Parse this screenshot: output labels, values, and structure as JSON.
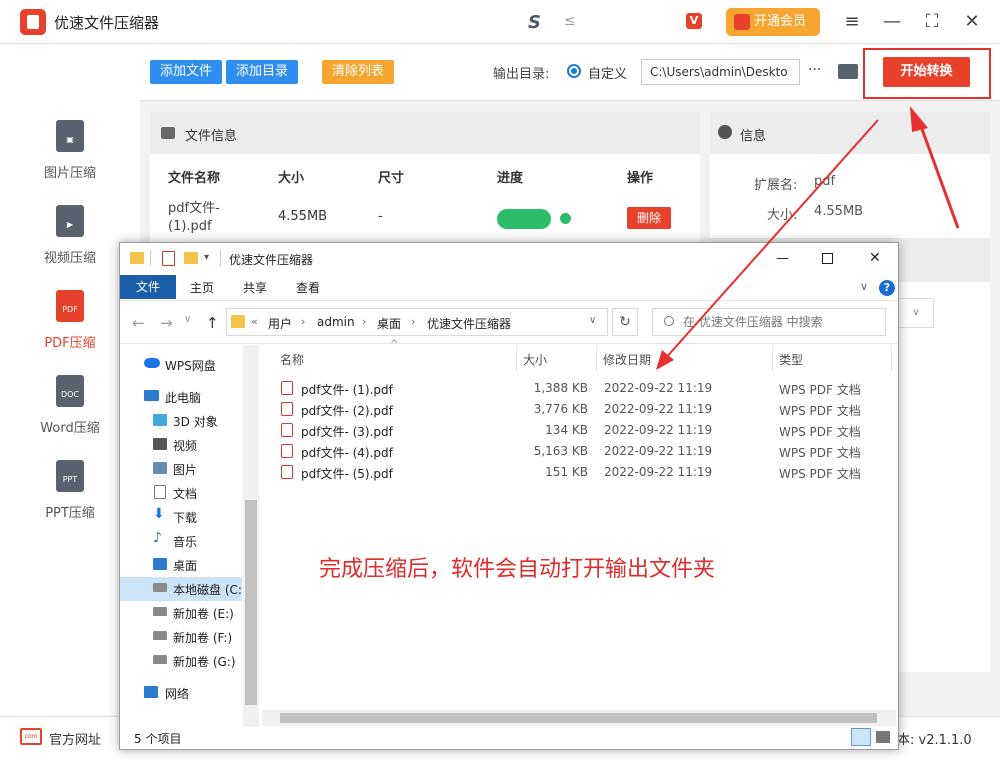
{
  "app": {
    "title": "优速文件压缩器",
    "center_logo": "S",
    "center_logo_suffix": "≤",
    "vip_label": "开通会员",
    "window_controls": [
      "≡",
      "—",
      "⛶",
      "✕"
    ]
  },
  "sidebar": {
    "items": [
      {
        "label": "图片压缩",
        "icon": "image-file-icon",
        "badge": "▣"
      },
      {
        "label": "视频压缩",
        "icon": "video-file-icon",
        "badge": "▶"
      },
      {
        "label": "PDF压缩",
        "icon": "pdf-file-icon",
        "badge": "PDF",
        "active": true
      },
      {
        "label": "Word压缩",
        "icon": "doc-file-icon",
        "badge": "DOC"
      },
      {
        "label": "PPT压缩",
        "icon": "ppt-file-icon",
        "badge": "PPT"
      }
    ]
  },
  "toolbar": {
    "add_file": "添加文件",
    "add_folder": "添加目录",
    "clear_list": "清除列表",
    "output_label": "输出目录:",
    "custom_label": "自定义",
    "output_path": "C:\\Users\\admin\\Deskto",
    "more": "···",
    "start": "开始转换"
  },
  "file_panel": {
    "title": "文件信息",
    "columns": [
      "文件名称",
      "大小",
      "尺寸",
      "进度",
      "操作"
    ],
    "rows": [
      {
        "name": "pdf文件-(1).pdf",
        "size": "4.55MB",
        "dimension": "-",
        "progress": 1.0,
        "action": "删除"
      }
    ]
  },
  "info_panel": {
    "title": "信息",
    "ext_label": "扩展名:",
    "ext_value": "pdf",
    "size_label": "大小:",
    "size_value": "4.55MB"
  },
  "bottom": {
    "site_icon_text": "com",
    "site_label": "官方网址",
    "version": "本: v2.1.1.0"
  },
  "explorer": {
    "title": "优速文件压缩器",
    "tabs": [
      "文件",
      "主页",
      "共享",
      "查看"
    ],
    "help": "?",
    "breadcrumb_prefix": "«",
    "breadcrumb": [
      "用户",
      "admin",
      "桌面",
      "优速文件压缩器"
    ],
    "search_placeholder": "在 优速文件压缩器 中搜索",
    "nav": [
      {
        "label": "WPS网盘",
        "icon": "cloud-icon"
      },
      {
        "label": "此电脑",
        "icon": "computer-icon"
      },
      {
        "label": "3D 对象",
        "icon": "3d-objects-icon"
      },
      {
        "label": "视频",
        "icon": "videos-folder-icon"
      },
      {
        "label": "图片",
        "icon": "pictures-folder-icon"
      },
      {
        "label": "文档",
        "icon": "documents-folder-icon"
      },
      {
        "label": "下载",
        "icon": "downloads-icon"
      },
      {
        "label": "音乐",
        "icon": "music-icon"
      },
      {
        "label": "桌面",
        "icon": "desktop-icon"
      },
      {
        "label": "本地磁盘 (C:)",
        "icon": "drive-c-icon"
      },
      {
        "label": "新加卷 (E:)",
        "icon": "drive-icon"
      },
      {
        "label": "新加卷 (F:)",
        "icon": "drive-icon"
      },
      {
        "label": "新加卷 (G:)",
        "icon": "drive-icon"
      },
      {
        "label": "网络",
        "icon": "network-icon"
      }
    ],
    "columns": [
      "名称",
      "大小",
      "修改日期",
      "类型"
    ],
    "files": [
      {
        "name": "pdf文件- (1).pdf",
        "size": "1,388 KB",
        "date": "2022-09-22 11:19",
        "type": "WPS PDF 文档"
      },
      {
        "name": "pdf文件- (2).pdf",
        "size": "3,776 KB",
        "date": "2022-09-22 11:19",
        "type": "WPS PDF 文档"
      },
      {
        "name": "pdf文件- (3).pdf",
        "size": "134 KB",
        "date": "2022-09-22 11:19",
        "type": "WPS PDF 文档"
      },
      {
        "name": "pdf文件- (4).pdf",
        "size": "5,163 KB",
        "date": "2022-09-22 11:19",
        "type": "WPS PDF 文档"
      },
      {
        "name": "pdf文件- (5).pdf",
        "size": "151 KB",
        "date": "2022-09-22 11:19",
        "type": "WPS PDF 文档"
      }
    ],
    "status": "5 个项目",
    "annotation": "完成压缩后，软件会自动打开输出文件夹"
  }
}
